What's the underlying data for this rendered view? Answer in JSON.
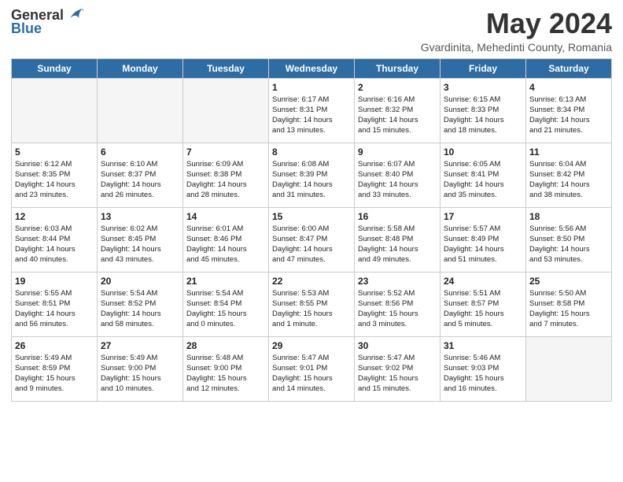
{
  "header": {
    "logo_general": "General",
    "logo_blue": "Blue",
    "title": "May 2024",
    "location": "Gvardinita, Mehedinti County, Romania"
  },
  "days_of_week": [
    "Sunday",
    "Monday",
    "Tuesday",
    "Wednesday",
    "Thursday",
    "Friday",
    "Saturday"
  ],
  "weeks": [
    [
      {
        "day": "",
        "info": ""
      },
      {
        "day": "",
        "info": ""
      },
      {
        "day": "",
        "info": ""
      },
      {
        "day": "1",
        "info": "Sunrise: 6:17 AM\nSunset: 8:31 PM\nDaylight: 14 hours\nand 13 minutes."
      },
      {
        "day": "2",
        "info": "Sunrise: 6:16 AM\nSunset: 8:32 PM\nDaylight: 14 hours\nand 15 minutes."
      },
      {
        "day": "3",
        "info": "Sunrise: 6:15 AM\nSunset: 8:33 PM\nDaylight: 14 hours\nand 18 minutes."
      },
      {
        "day": "4",
        "info": "Sunrise: 6:13 AM\nSunset: 8:34 PM\nDaylight: 14 hours\nand 21 minutes."
      }
    ],
    [
      {
        "day": "5",
        "info": "Sunrise: 6:12 AM\nSunset: 8:35 PM\nDaylight: 14 hours\nand 23 minutes."
      },
      {
        "day": "6",
        "info": "Sunrise: 6:10 AM\nSunset: 8:37 PM\nDaylight: 14 hours\nand 26 minutes."
      },
      {
        "day": "7",
        "info": "Sunrise: 6:09 AM\nSunset: 8:38 PM\nDaylight: 14 hours\nand 28 minutes."
      },
      {
        "day": "8",
        "info": "Sunrise: 6:08 AM\nSunset: 8:39 PM\nDaylight: 14 hours\nand 31 minutes."
      },
      {
        "day": "9",
        "info": "Sunrise: 6:07 AM\nSunset: 8:40 PM\nDaylight: 14 hours\nand 33 minutes."
      },
      {
        "day": "10",
        "info": "Sunrise: 6:05 AM\nSunset: 8:41 PM\nDaylight: 14 hours\nand 35 minutes."
      },
      {
        "day": "11",
        "info": "Sunrise: 6:04 AM\nSunset: 8:42 PM\nDaylight: 14 hours\nand 38 minutes."
      }
    ],
    [
      {
        "day": "12",
        "info": "Sunrise: 6:03 AM\nSunset: 8:44 PM\nDaylight: 14 hours\nand 40 minutes."
      },
      {
        "day": "13",
        "info": "Sunrise: 6:02 AM\nSunset: 8:45 PM\nDaylight: 14 hours\nand 43 minutes."
      },
      {
        "day": "14",
        "info": "Sunrise: 6:01 AM\nSunset: 8:46 PM\nDaylight: 14 hours\nand 45 minutes."
      },
      {
        "day": "15",
        "info": "Sunrise: 6:00 AM\nSunset: 8:47 PM\nDaylight: 14 hours\nand 47 minutes."
      },
      {
        "day": "16",
        "info": "Sunrise: 5:58 AM\nSunset: 8:48 PM\nDaylight: 14 hours\nand 49 minutes."
      },
      {
        "day": "17",
        "info": "Sunrise: 5:57 AM\nSunset: 8:49 PM\nDaylight: 14 hours\nand 51 minutes."
      },
      {
        "day": "18",
        "info": "Sunrise: 5:56 AM\nSunset: 8:50 PM\nDaylight: 14 hours\nand 53 minutes."
      }
    ],
    [
      {
        "day": "19",
        "info": "Sunrise: 5:55 AM\nSunset: 8:51 PM\nDaylight: 14 hours\nand 56 minutes."
      },
      {
        "day": "20",
        "info": "Sunrise: 5:54 AM\nSunset: 8:52 PM\nDaylight: 14 hours\nand 58 minutes."
      },
      {
        "day": "21",
        "info": "Sunrise: 5:54 AM\nSunset: 8:54 PM\nDaylight: 15 hours\nand 0 minutes."
      },
      {
        "day": "22",
        "info": "Sunrise: 5:53 AM\nSunset: 8:55 PM\nDaylight: 15 hours\nand 1 minute."
      },
      {
        "day": "23",
        "info": "Sunrise: 5:52 AM\nSunset: 8:56 PM\nDaylight: 15 hours\nand 3 minutes."
      },
      {
        "day": "24",
        "info": "Sunrise: 5:51 AM\nSunset: 8:57 PM\nDaylight: 15 hours\nand 5 minutes."
      },
      {
        "day": "25",
        "info": "Sunrise: 5:50 AM\nSunset: 8:58 PM\nDaylight: 15 hours\nand 7 minutes."
      }
    ],
    [
      {
        "day": "26",
        "info": "Sunrise: 5:49 AM\nSunset: 8:59 PM\nDaylight: 15 hours\nand 9 minutes."
      },
      {
        "day": "27",
        "info": "Sunrise: 5:49 AM\nSunset: 9:00 PM\nDaylight: 15 hours\nand 10 minutes."
      },
      {
        "day": "28",
        "info": "Sunrise: 5:48 AM\nSunset: 9:00 PM\nDaylight: 15 hours\nand 12 minutes."
      },
      {
        "day": "29",
        "info": "Sunrise: 5:47 AM\nSunset: 9:01 PM\nDaylight: 15 hours\nand 14 minutes."
      },
      {
        "day": "30",
        "info": "Sunrise: 5:47 AM\nSunset: 9:02 PM\nDaylight: 15 hours\nand 15 minutes."
      },
      {
        "day": "31",
        "info": "Sunrise: 5:46 AM\nSunset: 9:03 PM\nDaylight: 15 hours\nand 16 minutes."
      },
      {
        "day": "",
        "info": ""
      }
    ]
  ]
}
